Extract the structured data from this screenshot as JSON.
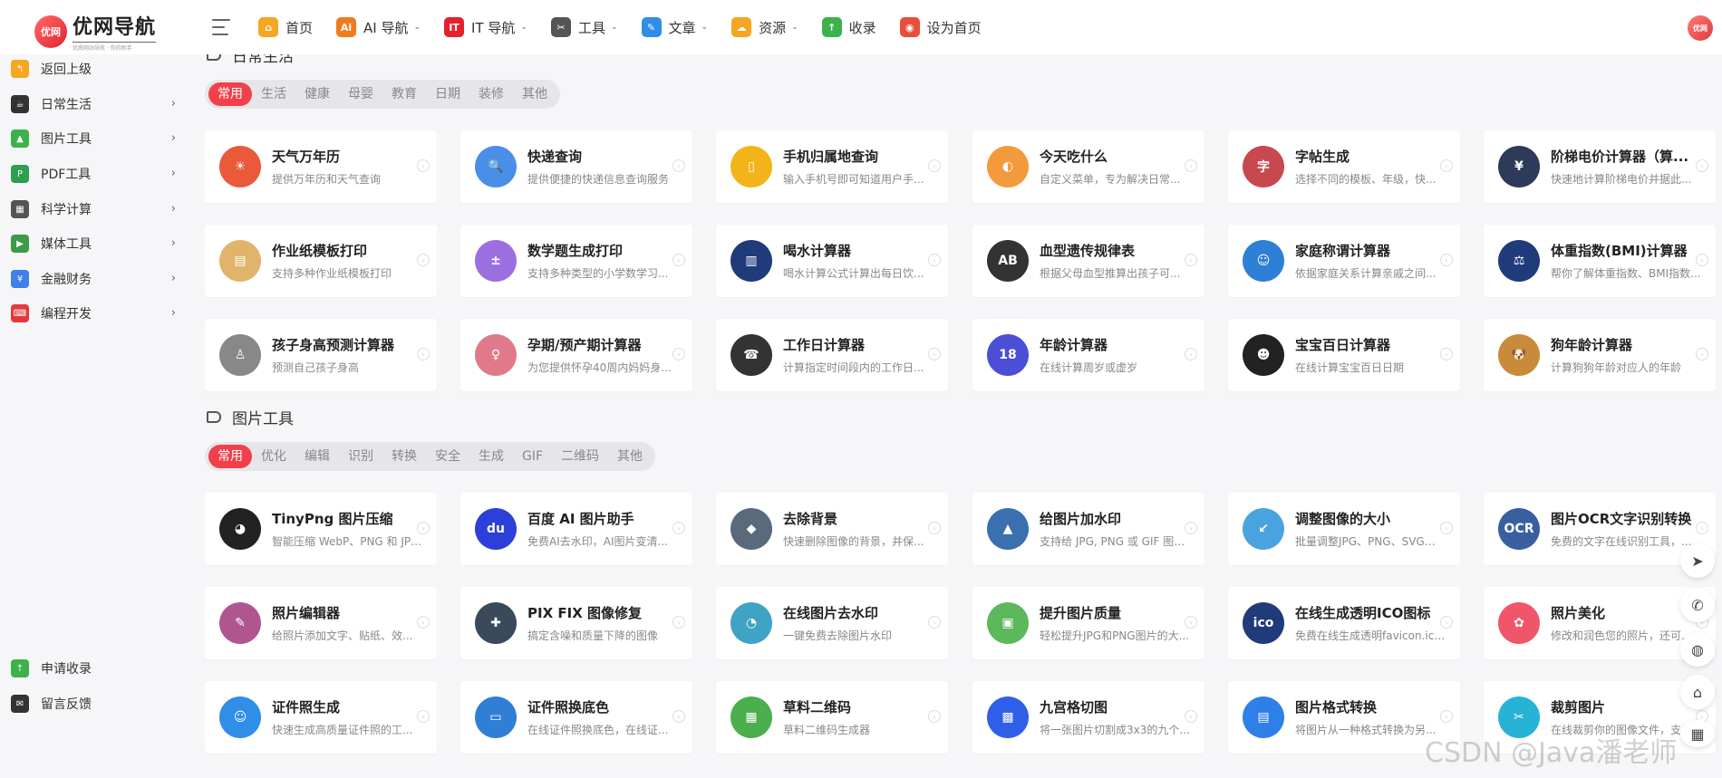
{
  "header": {
    "logo_badge": "优网",
    "logo_title": "优网导航",
    "logo_sub": "优质网站导航 · 你的助手",
    "nav": [
      {
        "label": "首页",
        "icon": "home-icon",
        "glyph": "⌂",
        "color": "#f5a623",
        "caret": false
      },
      {
        "label": "AI 导航",
        "icon": "ai-icon",
        "glyph": "Ai",
        "color": "#f07b1e",
        "caret": true
      },
      {
        "label": "IT 导航",
        "icon": "it-icon",
        "glyph": "IT",
        "color": "#e5202f",
        "caret": true
      },
      {
        "label": "工具",
        "icon": "tools-icon",
        "glyph": "✂",
        "color": "#555555",
        "caret": true
      },
      {
        "label": "文章",
        "icon": "article-icon",
        "glyph": "✎",
        "color": "#2f8ee8",
        "caret": true
      },
      {
        "label": "资源",
        "icon": "cloud-icon",
        "glyph": "☁",
        "color": "#f5a623",
        "caret": true
      },
      {
        "label": "收录",
        "icon": "submit-icon",
        "glyph": "↑",
        "color": "#3cb34a",
        "caret": false
      },
      {
        "label": "设为首页",
        "icon": "browser-icon",
        "glyph": "◉",
        "color": "#e84e3c",
        "caret": false
      }
    ],
    "avatar": "优网"
  },
  "sidebar": {
    "items": [
      {
        "label": "返回上级",
        "icon": "back-icon",
        "glyph": "↰",
        "color": "#f5a623",
        "arrow": false
      },
      {
        "label": "日常生活",
        "icon": "cup-icon",
        "glyph": "☕",
        "color": "#333333",
        "arrow": true
      },
      {
        "label": "图片工具",
        "icon": "image-icon",
        "glyph": "▲",
        "color": "#3cb34a",
        "arrow": true
      },
      {
        "label": "PDF工具",
        "icon": "pdf-icon",
        "glyph": "P",
        "color": "#2e9e4f",
        "arrow": true
      },
      {
        "label": "科学计算",
        "icon": "calculator-icon",
        "glyph": "▦",
        "color": "#555555",
        "arrow": true
      },
      {
        "label": "媒体工具",
        "icon": "media-icon",
        "glyph": "▶",
        "color": "#3a9b4a",
        "arrow": true
      },
      {
        "label": "金融财务",
        "icon": "finance-icon",
        "glyph": "¥",
        "color": "#3f7fe8",
        "arrow": true
      },
      {
        "label": "编程开发",
        "icon": "code-icon",
        "glyph": "⌨",
        "color": "#e5383b",
        "arrow": true
      }
    ],
    "bottom": [
      {
        "label": "申请收录",
        "icon": "apply-icon",
        "glyph": "↑",
        "color": "#3cb34a"
      },
      {
        "label": "留言反馈",
        "icon": "mail-icon",
        "glyph": "✉",
        "color": "#333333"
      }
    ],
    "arrow_glyph": "›"
  },
  "sections": [
    {
      "title": "日常生活",
      "tabs": [
        "常用",
        "生活",
        "健康",
        "母婴",
        "教育",
        "日期",
        "装修",
        "其他"
      ],
      "cards": [
        {
          "title": "天气万年历",
          "desc": "提供万年历和天气查询",
          "icon": "weather-calendar-icon",
          "glyph": "☀",
          "color": "#ea5a3a"
        },
        {
          "title": "快递查询",
          "desc": "提供便捷的快递信息查询服务",
          "icon": "express-search-icon",
          "glyph": "🔍",
          "color": "#4a8fe7"
        },
        {
          "title": "手机归属地查询",
          "desc": "输入手机号即可知道用户手...",
          "icon": "phone-location-icon",
          "glyph": "▯",
          "color": "#f2b418"
        },
        {
          "title": "今天吃什么",
          "desc": "自定义菜单，专为解决日常...",
          "icon": "food-icon",
          "glyph": "◐",
          "color": "#f39a3c"
        },
        {
          "title": "字帖生成",
          "desc": "选择不同的模板、年级，快...",
          "icon": "calligraphy-icon",
          "glyph": "字",
          "color": "#c7484f"
        },
        {
          "title": "阶梯电价计算器（算...",
          "desc": "快速地计算阶梯电价并据此...",
          "icon": "electricity-price-icon",
          "glyph": "¥",
          "color": "#2d3a5a"
        },
        {
          "title": "作业纸模板打印",
          "desc": "支持多种作业纸模板打印",
          "icon": "notebook-icon",
          "glyph": "▤",
          "color": "#e0b46a"
        },
        {
          "title": "数学题生成打印",
          "desc": "支持多种类型的小学数学习...",
          "icon": "math-icon",
          "glyph": "±",
          "color": "#9b6fe0"
        },
        {
          "title": "喝水计算器",
          "desc": "喝水计算公式计算出每日饮...",
          "icon": "water-cup-icon",
          "glyph": "▥",
          "color": "#1f3b7a"
        },
        {
          "title": "血型遗传规律表",
          "desc": "根据父母血型推算出孩子可...",
          "icon": "blood-type-icon",
          "glyph": "AB",
          "color": "#333333"
        },
        {
          "title": "家庭称谓计算器",
          "desc": "依据家庭关系计算亲戚之间...",
          "icon": "family-icon",
          "glyph": "☺",
          "color": "#2e7fd6"
        },
        {
          "title": "体重指数(BMI)计算器",
          "desc": "帮你了解体重指数、BMI指数...",
          "icon": "bmi-icon",
          "glyph": "⚖",
          "color": "#1f3b7a"
        },
        {
          "title": "孩子身高预测计算器",
          "desc": "预测自己孩子身高",
          "icon": "child-height-icon",
          "glyph": "♙",
          "color": "#888888"
        },
        {
          "title": "孕期/预产期计算器",
          "desc": "为您提供怀孕40周内妈妈身...",
          "icon": "pregnancy-icon",
          "glyph": "♀",
          "color": "#e07a8a"
        },
        {
          "title": "工作日计算器",
          "desc": "计算指定时间段内的工作日...",
          "icon": "workday-icon",
          "glyph": "☎",
          "color": "#333333"
        },
        {
          "title": "年龄计算器",
          "desc": "在线计算周岁或虚岁",
          "icon": "age-icon",
          "glyph": "18",
          "color": "#4a4fd6"
        },
        {
          "title": "宝宝百日计算器",
          "desc": "在线计算宝宝百日日期",
          "icon": "baby-icon",
          "glyph": "☻",
          "color": "#222222"
        },
        {
          "title": "狗年龄计算器",
          "desc": "计算狗狗年龄对应人的年龄",
          "icon": "dog-icon",
          "glyph": "🐶",
          "color": "#c98a3a"
        }
      ]
    },
    {
      "title": "图片工具",
      "tabs": [
        "常用",
        "优化",
        "编辑",
        "识别",
        "转换",
        "安全",
        "生成",
        "GIF",
        "二维码",
        "其他"
      ],
      "cards": [
        {
          "title": "TinyPng 图片压缩",
          "desc": "智能压缩 WebP、PNG 和 JPE...",
          "icon": "panda-icon",
          "glyph": "◕",
          "color": "#222222"
        },
        {
          "title": "百度 AI 图片助手",
          "desc": "免费AI去水印，AI图片变清...",
          "icon": "baidu-icon",
          "glyph": "du",
          "color": "#2c3fd8"
        },
        {
          "title": "去除背景",
          "desc": "快速删除图像的背景，并保...",
          "icon": "layers-icon",
          "glyph": "◆",
          "color": "#5a6a7a"
        },
        {
          "title": "给图片加水印",
          "desc": "支持给 JPG, PNG 或 GIF 图片...",
          "icon": "stamp-icon",
          "glyph": "▲",
          "color": "#3a6fb0"
        },
        {
          "title": "调整图像的大小",
          "desc": "批量调整JPG、PNG、SVG和...",
          "icon": "resize-icon",
          "glyph": "↙",
          "color": "#4aa3df"
        },
        {
          "title": "图片OCR文字识别转换",
          "desc": "免费的文字在线识别工具，...",
          "icon": "ocr-icon",
          "glyph": "OCR",
          "color": "#3a5fa0"
        },
        {
          "title": "照片编辑器",
          "desc": "给照片添加文字、贴纸、效...",
          "icon": "photo-editor-icon",
          "glyph": "✎",
          "color": "#b0568f"
        },
        {
          "title": "PIX FIX 图像修复",
          "desc": "搞定含噪和质量下降的图像",
          "icon": "pixfix-icon",
          "glyph": "✚",
          "color": "#3a4a5a"
        },
        {
          "title": "在线图片去水印",
          "desc": "一键免费去除图片水印",
          "icon": "watermark-remove-icon",
          "glyph": "◔",
          "color": "#3fa3c4"
        },
        {
          "title": "提升图片质量",
          "desc": "轻松提升JPG和PNG图片的大...",
          "icon": "enhance-icon",
          "glyph": "▣",
          "color": "#5cb85c"
        },
        {
          "title": "在线生成透明ICO图标",
          "desc": "免费在线生成透明favicon.ico...",
          "icon": "ico-icon",
          "glyph": "ico",
          "color": "#1f3b7a"
        },
        {
          "title": "照片美化",
          "desc": "修改和润色您的照片，还可...",
          "icon": "beautify-icon",
          "glyph": "✿",
          "color": "#f0566a"
        },
        {
          "title": "证件照生成",
          "desc": "快速生成高质量证件照的工...",
          "icon": "id-photo-icon",
          "glyph": "☺",
          "color": "#2f8ee8"
        },
        {
          "title": "证件照换底色",
          "desc": "在线证件照换底色，在线证...",
          "icon": "id-card-icon",
          "glyph": "▭",
          "color": "#2f7fd6"
        },
        {
          "title": "草料二维码",
          "desc": "草料二维码生成器",
          "icon": "qrcode-icon",
          "glyph": "▦",
          "color": "#4cae4c"
        },
        {
          "title": "九宫格切图",
          "desc": "将一张图片切割成3x3的九个...",
          "icon": "grid-cut-icon",
          "glyph": "▩",
          "color": "#2f5fe8"
        },
        {
          "title": "图片格式转换",
          "desc": "将图片从一种格式转换为另...",
          "icon": "format-convert-icon",
          "glyph": "▤",
          "color": "#2f7fe8"
        },
        {
          "title": "裁剪图片",
          "desc": "在线裁剪你的图像文件，支...",
          "icon": "crop-icon",
          "glyph": "✂",
          "color": "#26b3d6"
        }
      ]
    }
  ],
  "float_buttons": [
    {
      "icon": "back-to-top-icon",
      "glyph": "➤"
    },
    {
      "icon": "wechat-icon",
      "glyph": "✆"
    },
    {
      "icon": "qq-icon",
      "glyph": "◍"
    },
    {
      "icon": "tag-icon",
      "glyph": "⌂"
    },
    {
      "icon": "calendar-icon",
      "glyph": "▦"
    }
  ],
  "watermark": "CSDN @Java潘老师"
}
